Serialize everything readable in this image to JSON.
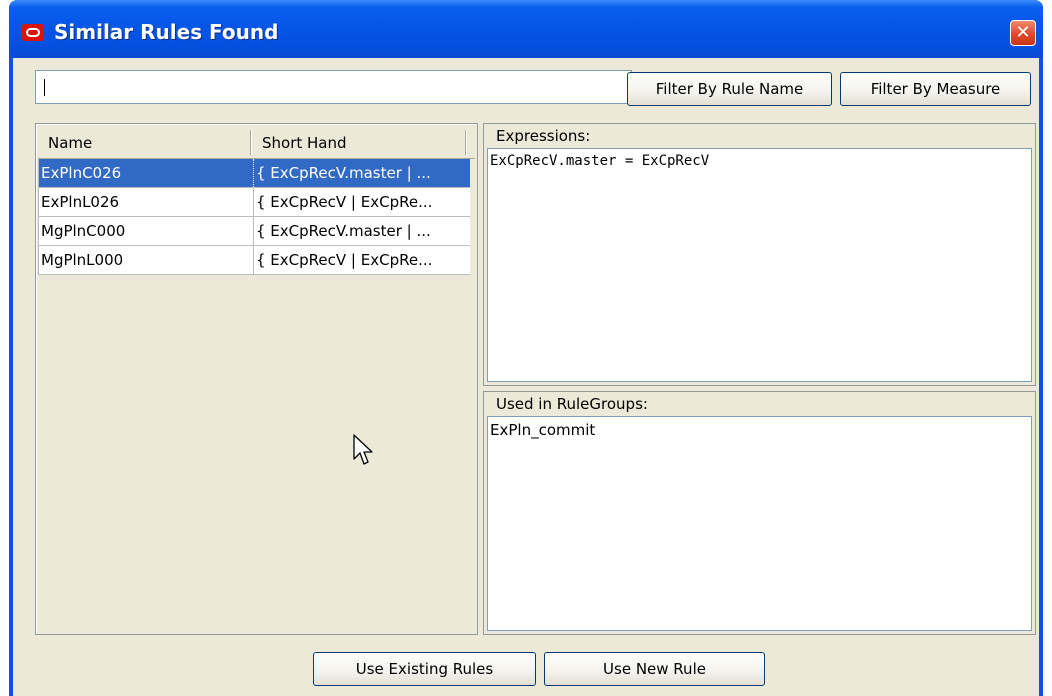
{
  "window": {
    "title": "Similar Rules Found",
    "close_glyph": "✕",
    "accent": "#0a54e3",
    "icon": "oracle-logo-icon"
  },
  "filter": {
    "value": "",
    "by_rule_name_label": "Filter By Rule Name",
    "by_measure_label": "Filter By Measure"
  },
  "rules_table": {
    "columns": [
      "Name",
      "Short Hand"
    ],
    "rows": [
      {
        "name": "ExPlnC026",
        "short_hand": "{ ExCpRecV.master | ...",
        "selected": true
      },
      {
        "name": "ExPlnL026",
        "short_hand": "{ ExCpRecV | ExCpRe...",
        "selected": false
      },
      {
        "name": "MgPlnC000",
        "short_hand": "{ ExCpRecV.master | ...",
        "selected": false
      },
      {
        "name": "MgPlnL000",
        "short_hand": "{ ExCpRecV | ExCpRe...",
        "selected": false
      }
    ],
    "selection_color": "#316ac5"
  },
  "expressions": {
    "label": "Expressions:",
    "text": "ExCpRecV.master = ExCpRecV"
  },
  "rulegroups": {
    "label": "Used in RuleGroups:",
    "text": "ExPln_commit"
  },
  "footer": {
    "use_existing_label": "Use Existing Rules",
    "use_new_label": "Use New Rule"
  }
}
